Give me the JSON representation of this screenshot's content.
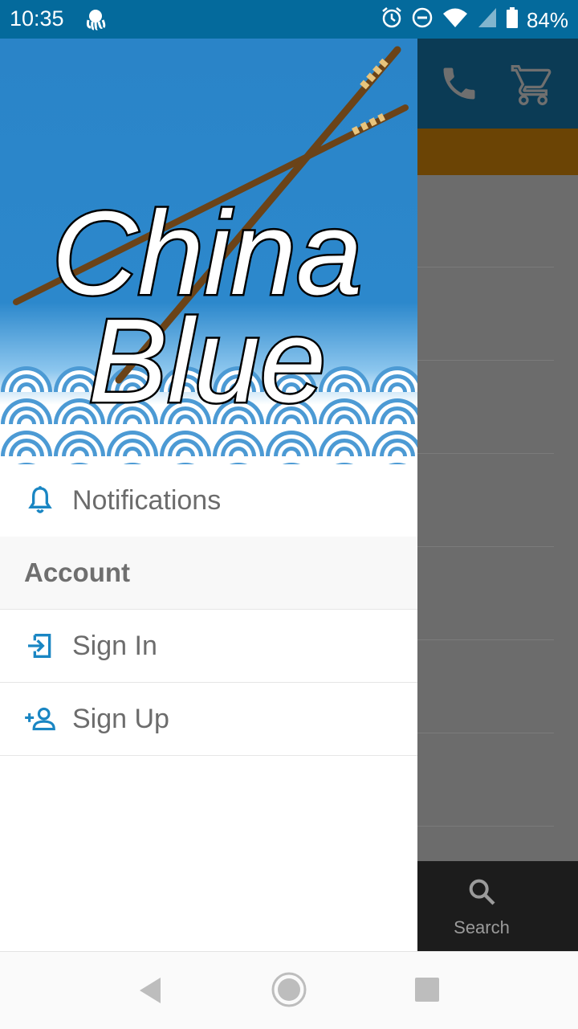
{
  "status_bar": {
    "time": "10:35",
    "battery": "84%"
  },
  "drawer": {
    "logo": {
      "line1": "China",
      "line2": "Blue"
    },
    "items": [
      {
        "label": "Notifications",
        "icon": "bell-icon"
      }
    ],
    "account_section": {
      "title": "Account",
      "items": [
        {
          "label": "Sign In",
          "icon": "sign-in-icon"
        },
        {
          "label": "Sign Up",
          "icon": "add-user-icon"
        }
      ]
    }
  },
  "background_app": {
    "bottom_nav": {
      "search_label": "Search"
    }
  },
  "colors": {
    "status_bar": "#046a9c",
    "header_blue": "#2a84c8",
    "accent_icon": "#1a86c3",
    "app_bar": "#0b3b55",
    "band": "#6b4405"
  }
}
